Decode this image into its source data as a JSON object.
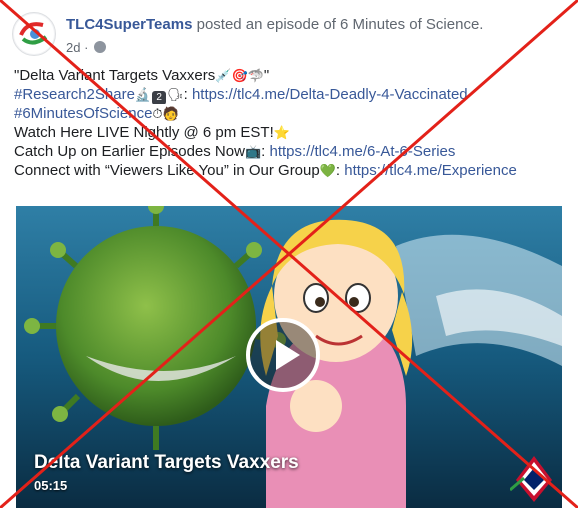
{
  "header": {
    "page_name": "TLC4SuperTeams",
    "posted_text": " posted an episode of 6 Minutes of Science.",
    "time": "2d",
    "separator": " · "
  },
  "post": {
    "line1": "\"Delta Variant Targets Vaxxers",
    "line1_end": "\"",
    "hashtag1": "#Research2Share",
    "after_tag1": ": ",
    "link1": "https://tlc4.me/Delta-Deadly-4-Vaccinated",
    "hashtag2": "#6MinutesOfScience",
    "line4": "Watch Here LIVE Nightly @ 6 pm EST!",
    "line5": "Catch Up on Earlier Episodes Now",
    "line5_sep": ": ",
    "link2": "https://tlc4.me/6-At-6-Series",
    "line6": "Connect with “Viewers Like You” in Our Group",
    "line6_sep": ": ",
    "link3": "https://tlc4.me/Experience"
  },
  "video": {
    "title": "Delta Variant Targets Vaxxers",
    "duration": "05:15"
  },
  "icons": [
    "globe-icon",
    "syringe-emoji",
    "target-emoji",
    "shark-emoji",
    "microscope-emoji",
    "number-2-emoji",
    "speaking-head-emoji",
    "stopwatch-emoji",
    "scientist-emoji",
    "star-emoji",
    "tv-emoji",
    "green-heart-emoji",
    "play-icon"
  ],
  "colors": {
    "link": "#385898",
    "cross": "#e32119"
  }
}
